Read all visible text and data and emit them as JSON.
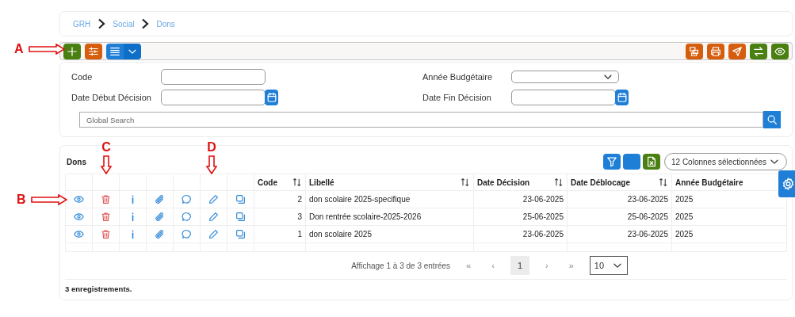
{
  "breadcrumb": [
    "GRH",
    "Social",
    "Dons"
  ],
  "filters": [
    {
      "label": "Code",
      "kind": "text"
    },
    {
      "label": "Année Budgétaire",
      "kind": "select"
    },
    {
      "label": "Date Début Décision",
      "kind": "date"
    },
    {
      "label": "Date Fin Décision",
      "kind": "date"
    }
  ],
  "global_search": {
    "placeholder": "Global Search"
  },
  "table": {
    "title": "Dons",
    "column_selector": "12 Colonnes sélectionnées",
    "columns": [
      {
        "label": "Code",
        "sortable": true
      },
      {
        "label": "Libellé",
        "sortable": true
      },
      {
        "label": "Date Décision",
        "sortable": true
      },
      {
        "label": "Date Déblocage",
        "sortable": true
      },
      {
        "label": "Année Budgétaire",
        "sortable": false
      }
    ],
    "rows": [
      {
        "code": "2",
        "libelle": "don scolaire 2025-specifique",
        "date_decision": "23-06-2025",
        "date_deblocage": "23-06-2025",
        "annee": "2025"
      },
      {
        "code": "3",
        "libelle": "Don rentrée scolaire-2025-2026",
        "date_decision": "25-06-2025",
        "date_deblocage": "25-06-2025",
        "annee": "2025"
      },
      {
        "code": "1",
        "libelle": "don scolaire 2025",
        "date_decision": "23-06-2025",
        "date_deblocage": "23-06-2025",
        "annee": "2025"
      }
    ]
  },
  "pagination": {
    "info": "Affichage 1 à 3 de 3 entrées",
    "first": "«",
    "prev": "‹",
    "pages": [
      {
        "label": "1",
        "selected": true
      }
    ],
    "next": "›",
    "last": "»",
    "page_size": "10"
  },
  "footer": "3 enregistrements.",
  "annotations": [
    {
      "label": "A"
    },
    {
      "label": "B"
    },
    {
      "label": "C"
    },
    {
      "label": "D"
    }
  ]
}
